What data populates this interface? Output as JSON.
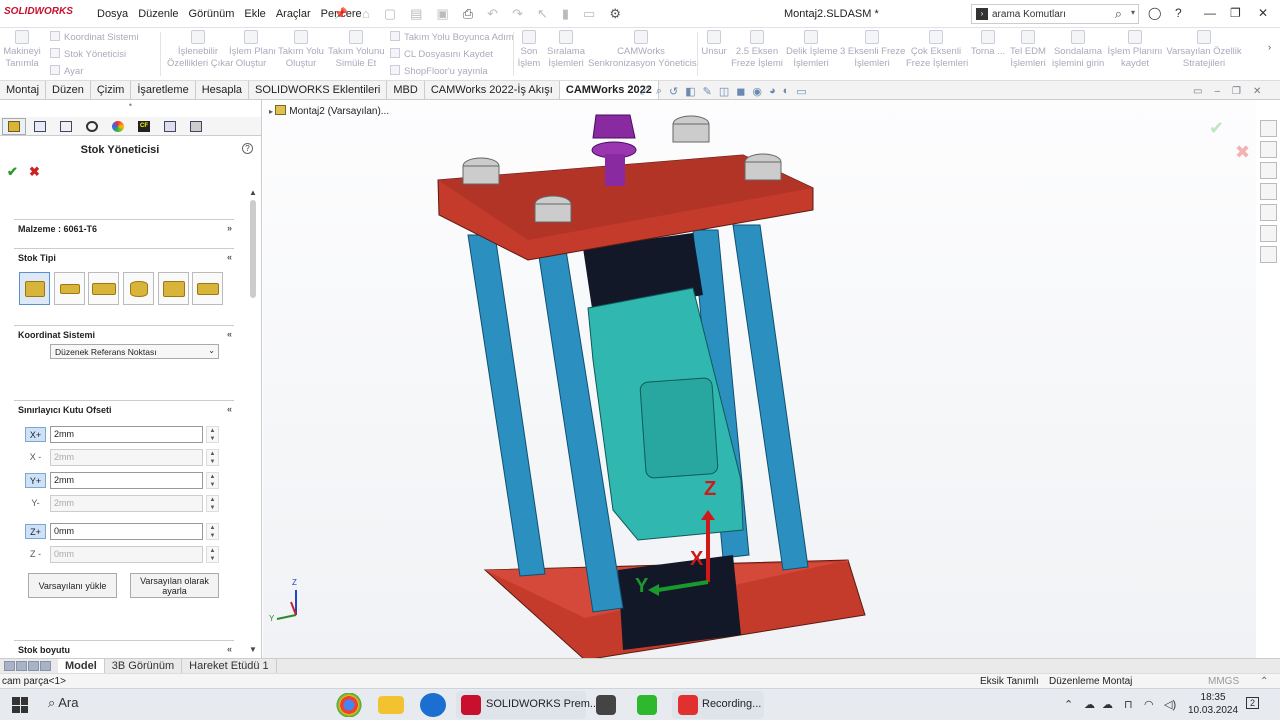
{
  "app": {
    "logo": "SOLIDWORKS",
    "document_title": "Montaj2.SLDASM *"
  },
  "menu": [
    "Dosya",
    "Düzenle",
    "Görünüm",
    "Ekle",
    "Araçlar",
    "Pencere"
  ],
  "search": {
    "placeholder": "arama Komutları"
  },
  "ribbon": {
    "items": [
      {
        "label": "Makineyi\nTanımla"
      },
      {
        "label": "İşlenebilir\nÖzellikleri Çıkar"
      },
      {
        "label": "İşlem Planı\nOluştur"
      },
      {
        "label": "Takım Yolu\nOluştur"
      },
      {
        "label": "Takım Yolunu\nSimüle Et"
      },
      {
        "label": "Son\nİşlem"
      },
      {
        "label": "Sıralama\nİşlemleri"
      },
      {
        "label": "CAMWorks\nSenkronizasyon Yöneticisi"
      },
      {
        "label": "Unsur"
      },
      {
        "label": "2.5 Eksen\nFreze İşlemi"
      },
      {
        "label": "Delik İşleme\nİşlemleri"
      },
      {
        "label": "3 Eksenli Freze\nİşlemleri"
      },
      {
        "label": "Çok Eksenli\nFreze İşlemleri"
      },
      {
        "label": "Torna ..."
      },
      {
        "label": "Tel EDM\nİşlemleri"
      },
      {
        "label": "Sondalama\nişlemini girin"
      },
      {
        "label": "İşlem Planını\nkaydet"
      },
      {
        "label": "Varsayılan Özellik\nStratejileri"
      }
    ],
    "small": [
      "Koordinat Sistemi",
      "Stok Yöneticisi",
      "Ayar",
      "Takım Yolu Boyunca Adım",
      "CL Dosyasını Kaydet",
      "ShopFloor'u yayınla"
    ]
  },
  "tabs": [
    "Montaj",
    "Düzen",
    "Çizim",
    "İşaretleme",
    "Hesapla",
    "SOLIDWORKS Eklentileri",
    "MBD",
    "CAMWorks 2022-İş Akışı",
    "CAMWorks 2022"
  ],
  "active_tab": "CAMWorks 2022",
  "panel": {
    "title": "Stok Yöneticisi",
    "material": "Malzeme : 6061-T6",
    "stock_type_label": "Stok Tipi",
    "coord_label": "Koordinat Sistemi",
    "coord_value": "Düzenek Referans Noktası",
    "offset_label": "Sınırlayıcı Kutu Ofseti",
    "offsets": [
      {
        "axis": "X+",
        "value": "2mm",
        "enabled": true
      },
      {
        "axis": "X -",
        "value": "2mm",
        "enabled": false
      },
      {
        "axis": "Y+",
        "value": "2mm",
        "enabled": true
      },
      {
        "axis": "Y-",
        "value": "2mm",
        "enabled": false
      },
      {
        "axis": "Z+",
        "value": "0mm",
        "enabled": true
      },
      {
        "axis": "Z -",
        "value": "0mm",
        "enabled": false
      }
    ],
    "load_defaults": "Varsayılanı yükle",
    "set_default": "Varsayılan olarak\nayarla",
    "stock_size": "Stok boyutu"
  },
  "viewport": {
    "tree_root": "Montaj2 (Varsayılan)...",
    "axis_labels": {
      "x": "X",
      "y": "Y",
      "z": "Z"
    }
  },
  "bottom_tabs": [
    "Model",
    "3B Görünüm",
    "Hareket Etüdü 1"
  ],
  "status": {
    "left": "cam parça<1>",
    "center1": "Eksik Tanımlı",
    "center2": "Düzenleme Montaj",
    "units": "MMGS"
  },
  "taskbar": {
    "search": "Ara",
    "app1": "SOLIDWORKS Prem...",
    "app2": "Recording...",
    "time": "18:35",
    "date": "10.03.2024",
    "notif": "2"
  },
  "colors": {
    "plate": "#c43b2c",
    "rod": "#2b90c0",
    "part": "#2fb7b0",
    "bolt": "#8a2aa0",
    "accent": "#c8102e"
  }
}
